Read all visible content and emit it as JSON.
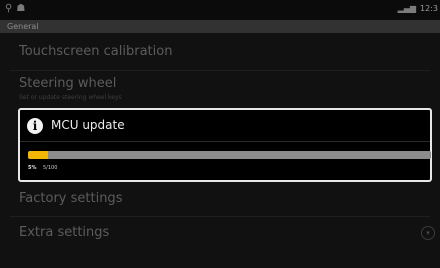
{
  "status_bar": {
    "usb_icon": "usb-icon",
    "debug_icon": "debug-icon",
    "signal_icon": "signal-bars-icon",
    "time": "12:3"
  },
  "section": {
    "header": "General"
  },
  "settings": {
    "touchscreen": {
      "title": "Touchscreen calibration"
    },
    "steering": {
      "title": "Steering wheel",
      "summary": "Set or update steering wheel keys"
    },
    "factory": {
      "title": "Factory settings"
    },
    "extra": {
      "title": "Extra settings",
      "icon": "expand-circle-icon"
    }
  },
  "dialog": {
    "icon": "info-icon",
    "title": "MCU update",
    "progress_percent_text": "5%",
    "progress_count_text": "5/100",
    "progress_fraction": 0.05,
    "accent_color": "#f2b705"
  }
}
